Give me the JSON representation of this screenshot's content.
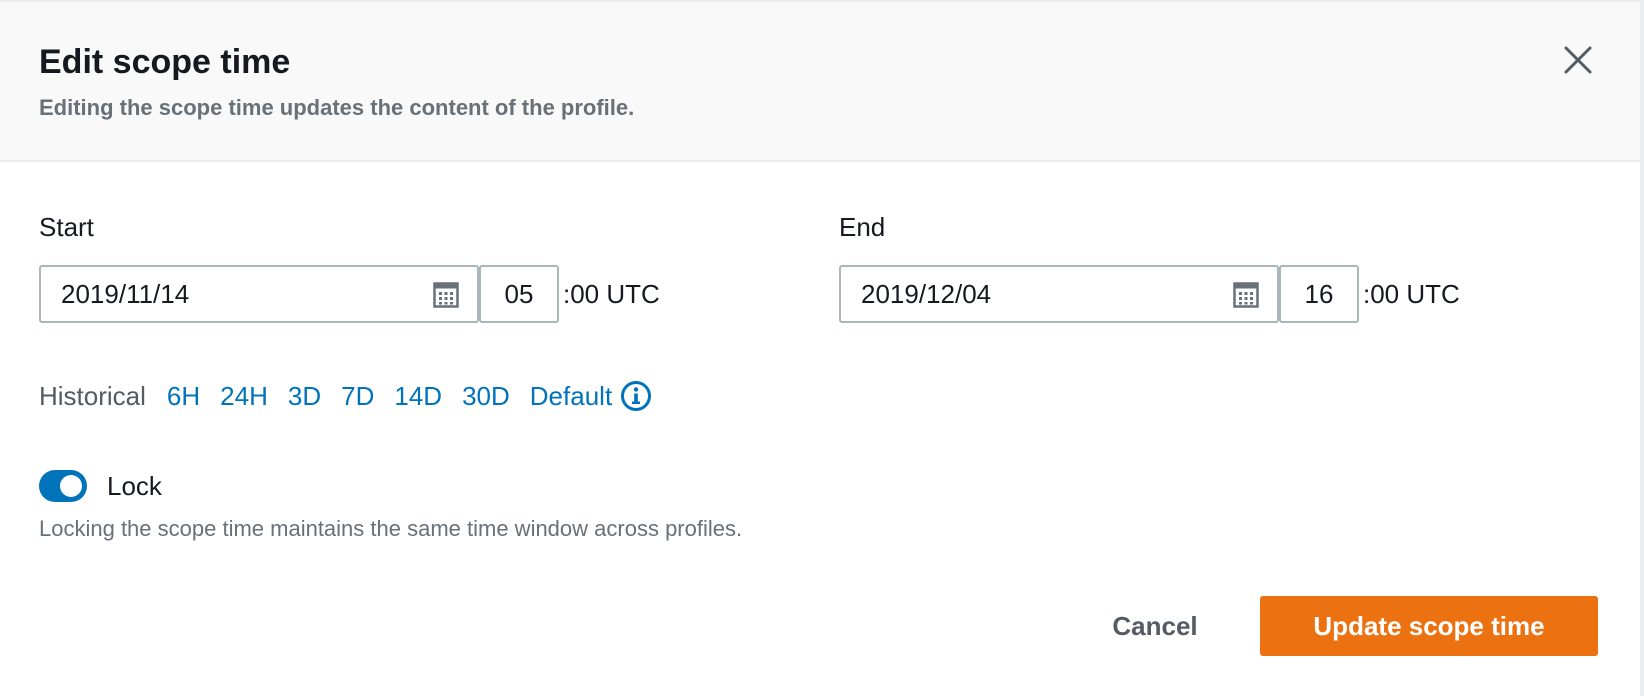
{
  "modal": {
    "title": "Edit scope time",
    "subtitle": "Editing the scope time updates the content of the profile.",
    "close_icon": "close-icon"
  },
  "start": {
    "label": "Start",
    "date": "2019/11/14",
    "hour": "05",
    "suffix": ":00 UTC",
    "icon": "calendar-icon"
  },
  "end": {
    "label": "End",
    "date": "2019/12/04",
    "hour": "16",
    "suffix": ":00 UTC",
    "icon": "calendar-icon"
  },
  "historical": {
    "label": "Historical",
    "ranges": [
      "6H",
      "24H",
      "3D",
      "7D",
      "14D",
      "30D"
    ],
    "default_label": "Default",
    "info_icon": "info-icon"
  },
  "lock": {
    "label": "Lock",
    "enabled": true,
    "description": "Locking the scope time maintains the same time window across profiles."
  },
  "actions": {
    "cancel_label": "Cancel",
    "submit_label": "Update scope time"
  },
  "colors": {
    "primary": "#ec7211",
    "link": "#0073bb",
    "toggle_on": "#0073bb"
  }
}
